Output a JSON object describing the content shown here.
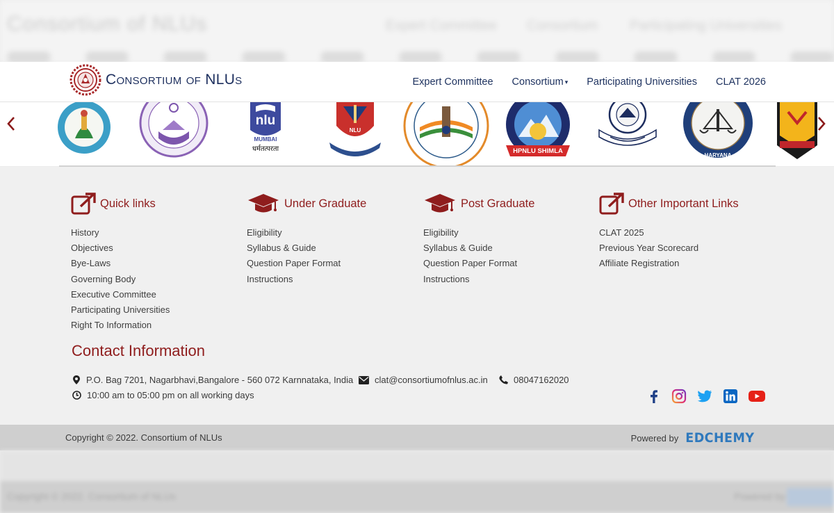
{
  "ghost": {
    "title": "Consortium of NLUs",
    "nav": [
      "Expert Committee",
      "Consortium",
      "Participating Universities",
      "CLAT 2026"
    ],
    "footer_left": "Copyright © 2022. Consortium of NLUs",
    "footer_right": "Powered by"
  },
  "header": {
    "brand": "Consortium of NLUs",
    "nav": [
      {
        "label": "Expert Committee"
      },
      {
        "label": "Consortium",
        "caret": "▾"
      },
      {
        "label": "Participating Universities"
      },
      {
        "label": "CLAT 2026"
      }
    ]
  },
  "carousel": {
    "prev_icon": "chevron-left-icon",
    "next_icon": "chevron-right-icon",
    "logos": {
      "mumbai_text": "nlu",
      "mumbai_sub": "MUMBAI",
      "mumbai_motto": "धर्मतत्परता",
      "nagpur_text": "NLU",
      "hpnlu_ribbon": "HPNLU SHIMLA",
      "haryana_text": "HARYANA"
    }
  },
  "footer": {
    "columns": [
      {
        "icon": "external-link-icon",
        "title": "Quick links",
        "items": [
          "History",
          "Objectives",
          "Bye-Laws",
          "Governing Body",
          "Executive Committee",
          "Participating Universities",
          "Right To Information"
        ]
      },
      {
        "icon": "graduation-cap-icon",
        "title": "Under Graduate",
        "items": [
          "Eligibility",
          "Syllabus & Guide",
          "Question Paper Format",
          "Instructions"
        ]
      },
      {
        "icon": "graduation-cap-icon",
        "title": "Post Graduate",
        "items": [
          "Eligibility",
          "Syllabus & Guide",
          "Question Paper Format",
          "Instructions"
        ]
      },
      {
        "icon": "external-link-icon",
        "title": "Other Important Links",
        "items": [
          "CLAT 2025",
          "Previous Year Scorecard",
          "Affiliate Registration"
        ]
      }
    ],
    "contact": {
      "title": "Contact Information",
      "address": "P.O. Bag 7201, Nagarbhavi,Bangalore - 560 072 Karnnataka, India",
      "email": "clat@consortiumofnlus.ac.in",
      "phone": "08047162020",
      "hours": "10:00 am to 05:00 pm on all working days"
    },
    "social": [
      "facebook-icon",
      "instagram-icon",
      "twitter-icon",
      "linkedin-icon",
      "youtube-icon"
    ]
  },
  "bottom": {
    "copyright": "Copyright © 2022. Consortium of NLUs",
    "powered_by": "Powered by",
    "powered_brand": "EDCHEMY"
  },
  "colors": {
    "accent": "#8f1d1d",
    "nav_text": "#1f3360",
    "edchemy": "#2f79bd"
  }
}
